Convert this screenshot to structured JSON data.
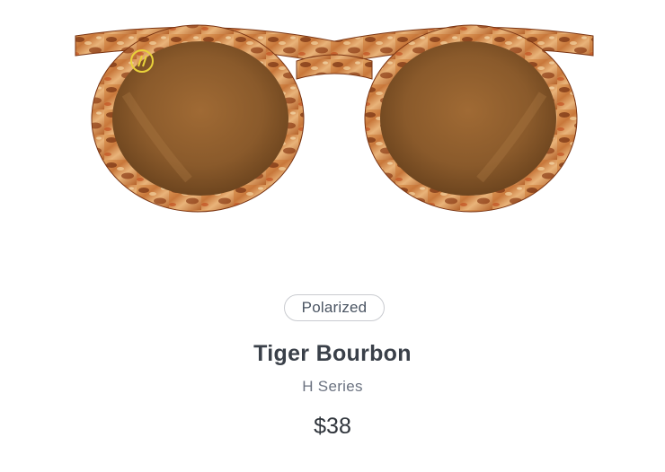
{
  "product": {
    "image_alt": "Tiger Bourbon sunglasses",
    "badge": "Polarized",
    "name": "Tiger Bourbon",
    "series": "H Series",
    "price": "$38"
  },
  "colors": {
    "frame_base": "#c8773a",
    "frame_dark": "#7a3412",
    "frame_light": "#f0c68a",
    "lens": "#8a5a2b",
    "logo": "#e9d23a",
    "badge_border": "#c9cbd0",
    "title_text": "#3a4049",
    "subtitle_text": "#6b7280"
  },
  "icons": {
    "brand_logo": "double-slash-logo-icon"
  }
}
